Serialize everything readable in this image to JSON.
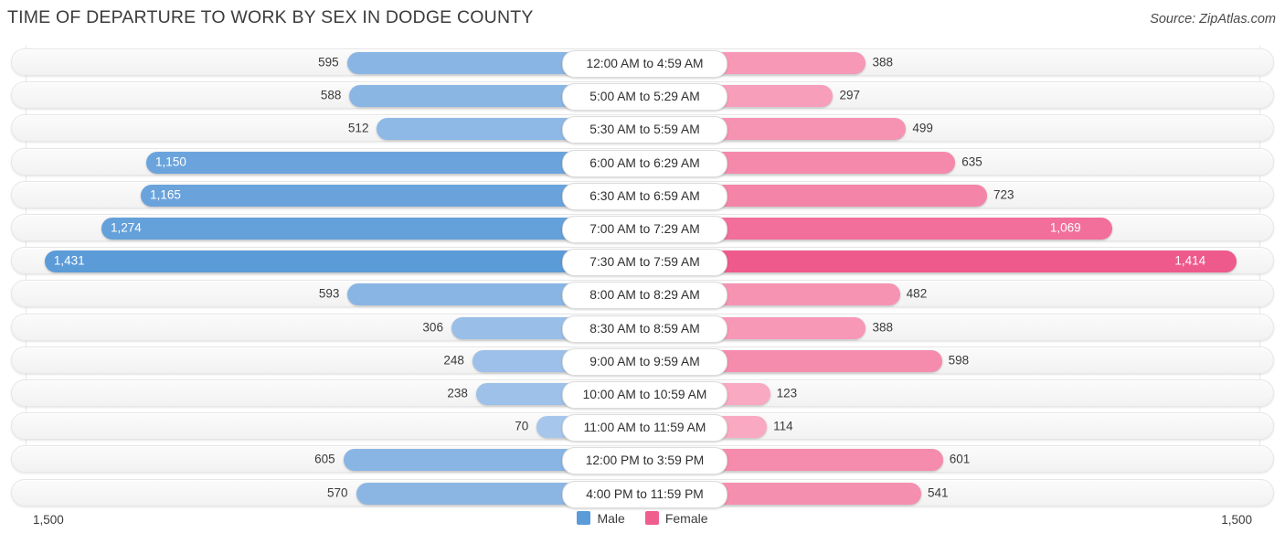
{
  "header": {
    "title": "TIME OF DEPARTURE TO WORK BY SEX IN DODGE COUNTY",
    "source": "Source: ZipAtlas.com"
  },
  "legend": {
    "male_label": "Male",
    "female_label": "Female",
    "male_color": "#5b9bd8",
    "female_color": "#ef5f8e"
  },
  "axis": {
    "left_label": "1,500",
    "right_label": "1,500",
    "max": 1500
  },
  "chart_data": {
    "type": "bar",
    "orientation": "horizontal-diverging",
    "title": "TIME OF DEPARTURE TO WORK BY SEX IN DODGE COUNTY",
    "xlabel": "",
    "ylabel": "",
    "xlim": [
      1500,
      1500
    ],
    "grid": true,
    "legend_position": "bottom-center",
    "categories": [
      "12:00 AM to 4:59 AM",
      "5:00 AM to 5:29 AM",
      "5:30 AM to 5:59 AM",
      "6:00 AM to 6:29 AM",
      "6:30 AM to 6:59 AM",
      "7:00 AM to 7:29 AM",
      "7:30 AM to 7:59 AM",
      "8:00 AM to 8:29 AM",
      "8:30 AM to 8:59 AM",
      "9:00 AM to 9:59 AM",
      "10:00 AM to 10:59 AM",
      "11:00 AM to 11:59 AM",
      "12:00 PM to 3:59 PM",
      "4:00 PM to 11:59 PM"
    ],
    "series": [
      {
        "name": "Male",
        "values": [
          595,
          588,
          512,
          1150,
          1165,
          1274,
          1431,
          593,
          306,
          248,
          238,
          70,
          605,
          570
        ],
        "labels": [
          "595",
          "588",
          "512",
          "1,150",
          "1,165",
          "1,274",
          "1,431",
          "593",
          "306",
          "248",
          "238",
          "70",
          "605",
          "570"
        ]
      },
      {
        "name": "Female",
        "values": [
          388,
          297,
          499,
          635,
          723,
          1069,
          1414,
          482,
          388,
          598,
          123,
          114,
          601,
          541
        ],
        "labels": [
          "388",
          "297",
          "499",
          "635",
          "723",
          "1,069",
          "1,414",
          "482",
          "388",
          "598",
          "123",
          "114",
          "601",
          "541"
        ]
      }
    ]
  }
}
